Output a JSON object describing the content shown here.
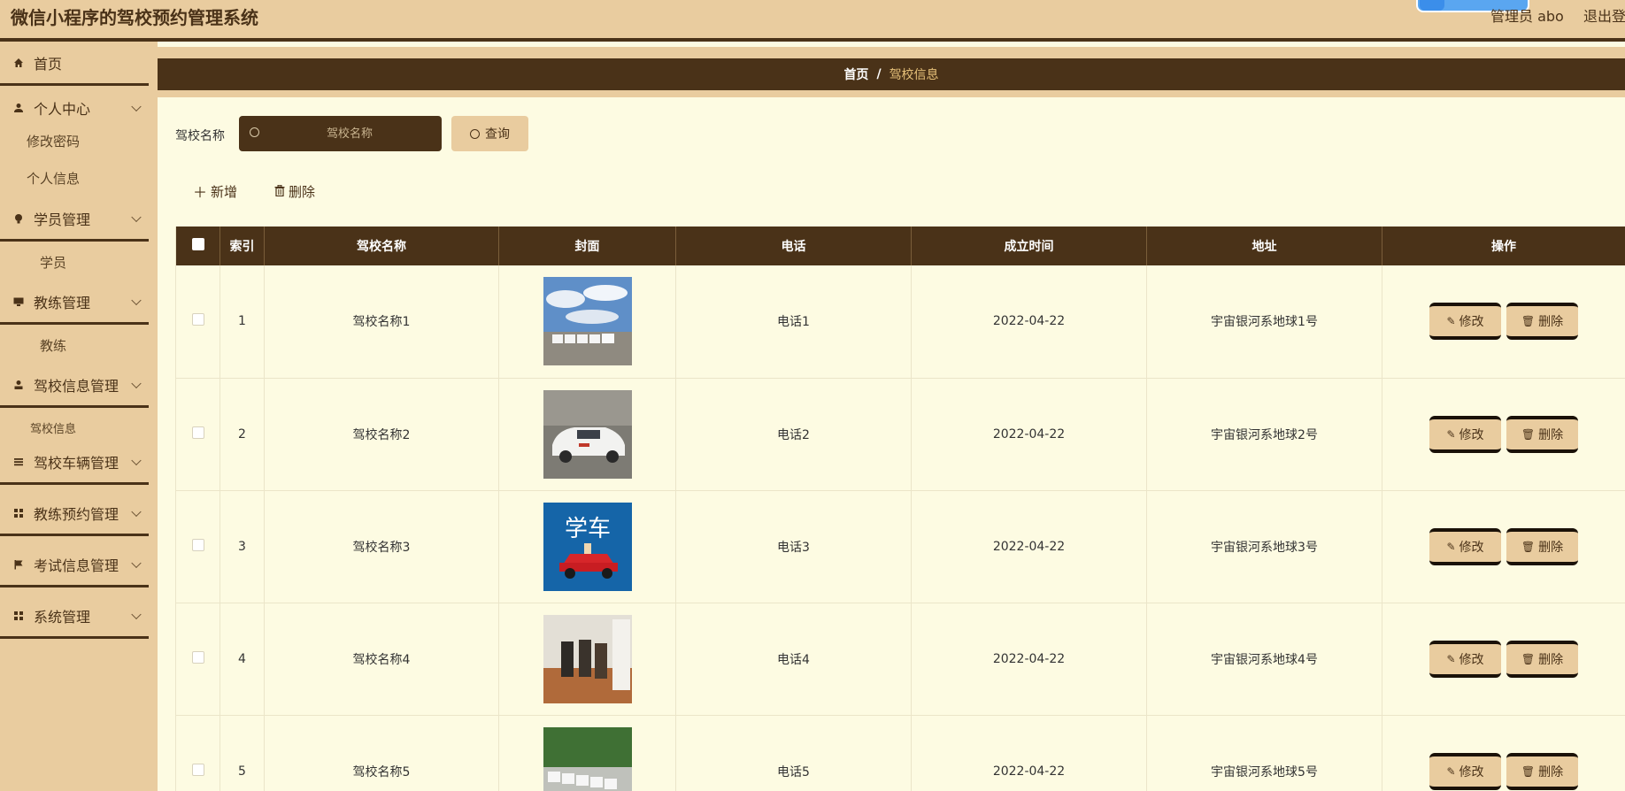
{
  "app": {
    "title": "微信小程序的驾校预约管理系统",
    "user": "管理员 abo",
    "logout": "退出登"
  },
  "sidebar": {
    "items": [
      {
        "label": "首页",
        "icon": "home-icon"
      },
      {
        "label": "个人中心",
        "icon": "user-icon",
        "children": [
          "修改密码",
          "个人信息"
        ]
      },
      {
        "label": "学员管理",
        "icon": "bulb-icon",
        "children": [
          "学员"
        ]
      },
      {
        "label": "教练管理",
        "icon": "monitor-icon",
        "children": [
          "教练"
        ]
      },
      {
        "label": "驾校信息管理",
        "icon": "person-icon",
        "children": [
          "驾校信息"
        ]
      },
      {
        "label": "驾校车辆管理",
        "icon": "list-icon"
      },
      {
        "label": "教练预约管理",
        "icon": "grid-icon"
      },
      {
        "label": "考试信息管理",
        "icon": "flag-icon"
      },
      {
        "label": "系统管理",
        "icon": "grid-icon"
      }
    ]
  },
  "breadcrumb": {
    "home": "首页",
    "separator": "/",
    "current": "驾校信息"
  },
  "search": {
    "label": "驾校名称",
    "placeholder": "驾校名称",
    "button": "查询"
  },
  "toolbar": {
    "add": "新增",
    "delete": "删除"
  },
  "table": {
    "columns": [
      "索引",
      "驾校名称",
      "封面",
      "电话",
      "成立时间",
      "地址",
      "操作"
    ],
    "rows": [
      {
        "index": "1",
        "name": "驾校名称1",
        "cover": "cover-image-1",
        "phone": "电话1",
        "date": "2022-04-22",
        "address": "宇宙银河系地球1号"
      },
      {
        "index": "2",
        "name": "驾校名称2",
        "cover": "cover-image-2",
        "phone": "电话2",
        "date": "2022-04-22",
        "address": "宇宙银河系地球2号"
      },
      {
        "index": "3",
        "name": "驾校名称3",
        "cover": "cover-image-3",
        "phone": "电话3",
        "date": "2022-04-22",
        "address": "宇宙银河系地球3号"
      },
      {
        "index": "4",
        "name": "驾校名称4",
        "cover": "cover-image-4",
        "phone": "电话4",
        "date": "2022-04-22",
        "address": "宇宙银河系地球4号"
      },
      {
        "index": "5",
        "name": "驾校名称5",
        "cover": "cover-image-5",
        "phone": "电话5",
        "date": "2022-04-22",
        "address": "宇宙银河系地球5号"
      }
    ],
    "actions": {
      "edit": "修改",
      "delete": "删除"
    },
    "cover_texts": {
      "three": "学车"
    }
  },
  "colors": {
    "primary": "#4a3218",
    "accent": "#e9cc9f",
    "background": "#fdfbe2",
    "breadcrumb_current": "#e8c27a"
  }
}
